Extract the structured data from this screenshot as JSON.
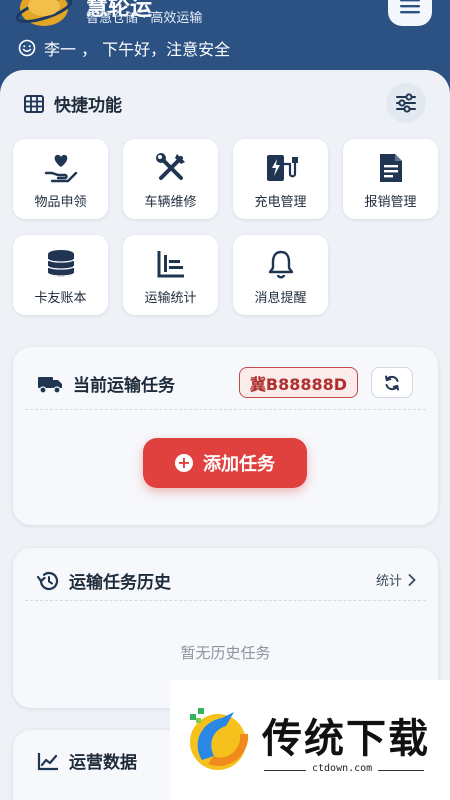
{
  "header": {
    "app_name": "慧轮运",
    "slogan": "智慧仓储 · 高效运输",
    "greeting": "李一 ， 下午好，注意安全"
  },
  "quick": {
    "title": "快捷功能",
    "items": [
      {
        "label": "物品申领",
        "icon": "hand-heart-icon"
      },
      {
        "label": "车辆维修",
        "icon": "wrench-screwdriver-icon"
      },
      {
        "label": "充电管理",
        "icon": "charging-station-icon"
      },
      {
        "label": "报销管理",
        "icon": "document-icon"
      },
      {
        "label": "卡友账本",
        "icon": "coin-stack-icon"
      },
      {
        "label": "运输统计",
        "icon": "bar-chart-icon"
      },
      {
        "label": "消息提醒",
        "icon": "bell-icon"
      }
    ]
  },
  "current_task": {
    "title": "当前运输任务",
    "plate": "冀B88888D",
    "add_label": "添加任务"
  },
  "history": {
    "title": "运输任务历史",
    "link": "统计",
    "empty": "暂无历史任务"
  },
  "ops": {
    "title": "运营数据"
  },
  "watermark": {
    "title": "传统下载",
    "url": "ctdown.com"
  },
  "colors": {
    "header_bg": "#2c5283",
    "sheet_bg": "#eef2f7",
    "primary_icon": "#1f3552",
    "accent_red": "#e0413e"
  }
}
